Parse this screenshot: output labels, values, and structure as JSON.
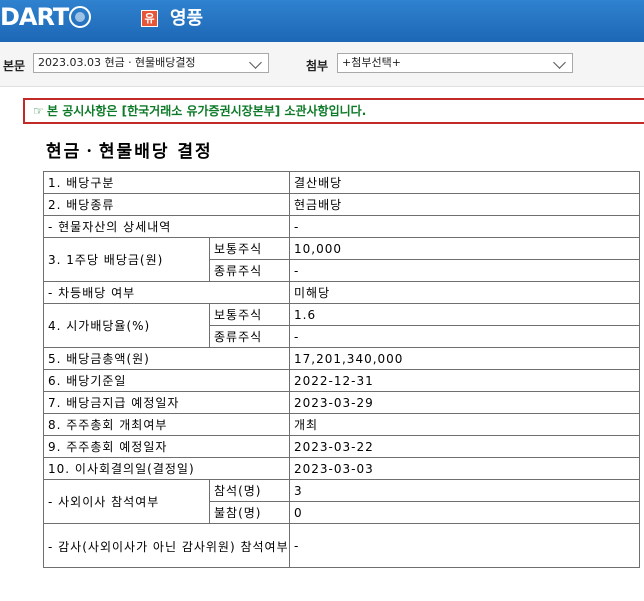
{
  "header": {
    "logo": "DART",
    "company_badge": "유",
    "company_name": "영풍"
  },
  "selectors": {
    "body_label": "본문",
    "body_value": "2023.03.03  현금ㆍ현물배당결정",
    "attach_label": "첨부",
    "attach_value": "+첨부선택+"
  },
  "notice": {
    "icon": "☞",
    "text": "본 공시사항은 [한국거래소 유가증권시장본부] 소관사항입니다."
  },
  "document": {
    "title": "현금ㆍ현물배당 결정",
    "rows": {
      "r1": {
        "label": "1. 배당구분",
        "value": "결산배당"
      },
      "r2": {
        "label": "2. 배당종류",
        "value": "현금배당"
      },
      "r3": {
        "label": "- 현물자산의 상세내역",
        "value": "-"
      },
      "r4": {
        "label": "3. 1주당 배당금(원)",
        "sub1": "보통주식",
        "val1": "10,000",
        "sub2": "종류주식",
        "val2": "-"
      },
      "r5": {
        "label": "- 차등배당 여부",
        "value": "미해당"
      },
      "r6": {
        "label": "4. 시가배당율(%)",
        "sub1": "보통주식",
        "val1": "1.6",
        "sub2": "종류주식",
        "val2": "-"
      },
      "r7": {
        "label": "5. 배당금총액(원)",
        "value": "17,201,340,000"
      },
      "r8": {
        "label": "6. 배당기준일",
        "value": "2022-12-31"
      },
      "r9": {
        "label": "7. 배당금지급 예정일자",
        "value": "2023-03-29"
      },
      "r10": {
        "label": "8. 주주총회 개최여부",
        "value": "개최"
      },
      "r11": {
        "label": "9. 주주총회 예정일자",
        "value": "2023-03-22"
      },
      "r12": {
        "label": "10. 이사회결의일(결정일)",
        "value": "2023-03-03"
      },
      "r13": {
        "label": "- 사외이사 참석여부",
        "sub1": "참석(명)",
        "val1": "3",
        "sub2": "불참(명)",
        "val2": "0"
      },
      "r14": {
        "label": "- 감사(사외이사가 아닌 감사위원) 참석여부",
        "value": "-"
      }
    }
  }
}
